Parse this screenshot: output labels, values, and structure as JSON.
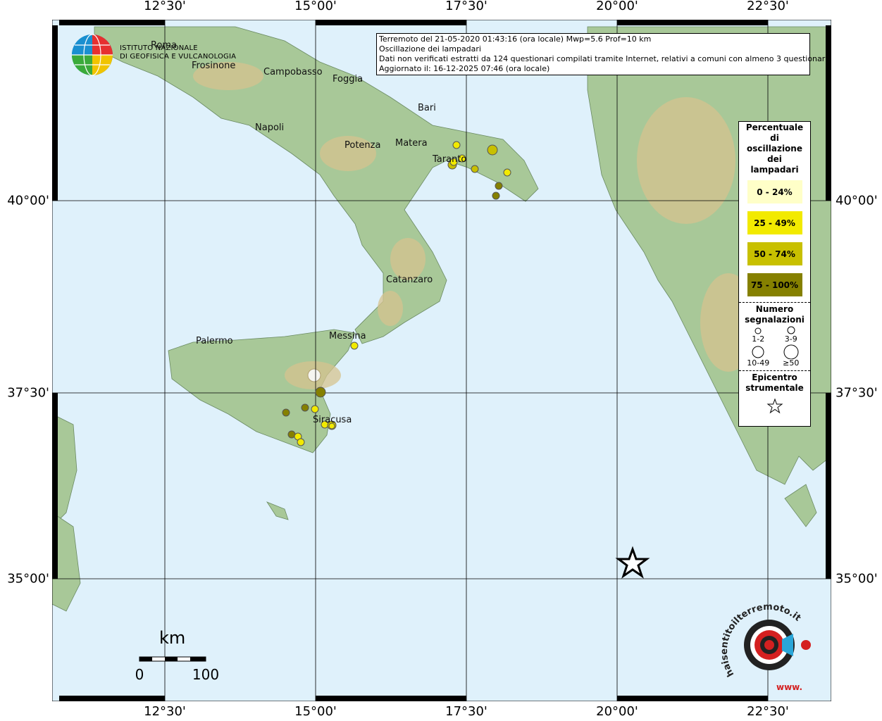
{
  "info": {
    "line1": "Terremoto del 21-05-2020 01:43:16 (ora locale) Mwp=5.6 Prof=10 km",
    "line2": "Oscillazione dei lampadari",
    "line3": "Dati non verificati estratti da 124 questionari compilati tramite Internet, relativi a comuni con almeno 3 questionari.",
    "line4": "Aggiornato il: 16-12-2025 07:46 (ora locale)"
  },
  "axes": {
    "longitudes": [
      "12°30'",
      "15°00'",
      "17°30'",
      "20°00'",
      "22°30'"
    ],
    "latitudes": [
      "40°00'",
      "37°30'",
      "35°00'"
    ]
  },
  "legend": {
    "title": "Percentuale di oscillazione dei lampadari",
    "classes": [
      {
        "label": "0 - 24%",
        "color": "#ffffc8"
      },
      {
        "label": "25 - 49%",
        "color": "#f2ea00"
      },
      {
        "label": "50 - 74%",
        "color": "#c8c000"
      },
      {
        "label": "75 - 100%",
        "color": "#858000"
      }
    ],
    "count_title": "Numero segnalazioni",
    "counts": [
      "1-2",
      "3-9",
      "10-49",
      "≥50"
    ],
    "epicenter_title": "Epicentro strumentale"
  },
  "logo": {
    "ingv_line1": "ISTITUTO NAZIONALE",
    "ingv_line2": "DI GEOFISICA E VULCANOLOGIA",
    "hst_text": "haisentitoilterremoto.it",
    "hst_www": "www."
  },
  "cities": [
    {
      "name": "Roma"
    },
    {
      "name": "Frosinone"
    },
    {
      "name": "Campobasso"
    },
    {
      "name": "Foggia"
    },
    {
      "name": "Bari"
    },
    {
      "name": "Napoli"
    },
    {
      "name": "Potenza"
    },
    {
      "name": "Matera"
    },
    {
      "name": "Taranto"
    },
    {
      "name": "Catanzaro"
    },
    {
      "name": "Messina"
    },
    {
      "name": "Palermo"
    },
    {
      "name": "Siracusa"
    }
  ],
  "scale": {
    "unit": "km",
    "min": "0",
    "max": "100"
  },
  "colors": {
    "sea": "#dff1fb",
    "land": "#a8c898",
    "relief": "#d6c38f",
    "grid": "#000000"
  }
}
